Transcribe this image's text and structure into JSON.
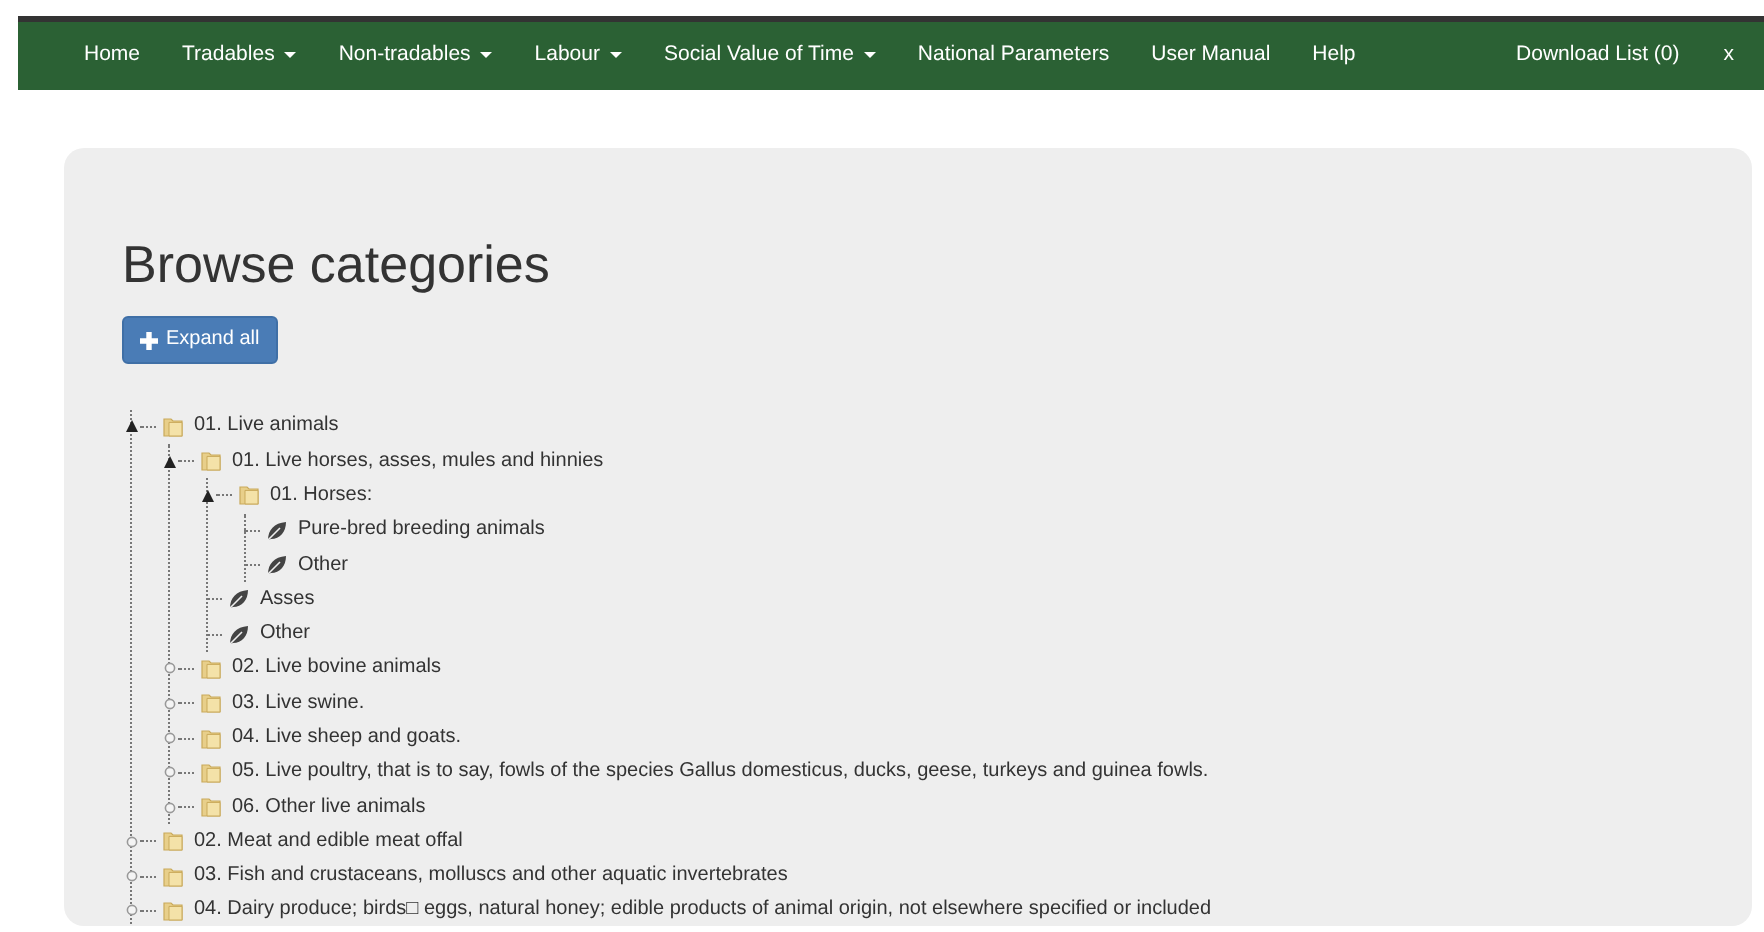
{
  "navbar": {
    "items": [
      {
        "label": "Home",
        "dropdown": false
      },
      {
        "label": "Tradables",
        "dropdown": true
      },
      {
        "label": "Non-tradables",
        "dropdown": true
      },
      {
        "label": "Labour",
        "dropdown": true
      },
      {
        "label": "Social Value of Time",
        "dropdown": true
      },
      {
        "label": "National Parameters",
        "dropdown": false
      },
      {
        "label": "User Manual",
        "dropdown": false
      },
      {
        "label": "Help",
        "dropdown": false
      }
    ],
    "right": [
      {
        "label": "Download List (0)"
      },
      {
        "label": "x"
      }
    ]
  },
  "page": {
    "title": "Browse categories",
    "expand_button": "Expand all"
  },
  "tree": [
    {
      "kind": "folder",
      "label": "01. Live animals",
      "expanded": true,
      "children": [
        {
          "kind": "folder",
          "label": "01. Live horses, asses, mules and hinnies",
          "expanded": true,
          "children": [
            {
              "kind": "folder",
              "label": "01. Horses:",
              "expanded": true,
              "children": [
                {
                  "kind": "leaf",
                  "label": "Pure-bred breeding animals"
                },
                {
                  "kind": "leaf",
                  "label": "Other"
                }
              ]
            },
            {
              "kind": "leaf",
              "label": "Asses"
            },
            {
              "kind": "leaf",
              "label": "Other"
            }
          ]
        },
        {
          "kind": "folder",
          "label": "02. Live bovine animals",
          "expanded": false
        },
        {
          "kind": "folder",
          "label": "03. Live swine.",
          "expanded": false
        },
        {
          "kind": "folder",
          "label": "04. Live sheep and goats.",
          "expanded": false
        },
        {
          "kind": "folder",
          "label": "05. Live poultry, that is to say, fowls of the species Gallus domesticus, ducks, geese, turkeys and guinea fowls.",
          "expanded": false
        },
        {
          "kind": "folder",
          "label": "06. Other live animals",
          "expanded": false
        }
      ]
    },
    {
      "kind": "folder",
      "label": "02. Meat and edible meat offal",
      "expanded": false
    },
    {
      "kind": "folder",
      "label": "03. Fish and crustaceans, molluscs and other aquatic invertebrates",
      "expanded": false
    },
    {
      "kind": "folder",
      "label": "04. Dairy produce; birds□ eggs, natural honey; edible products of animal origin, not elsewhere specified or included",
      "expanded": false
    }
  ]
}
